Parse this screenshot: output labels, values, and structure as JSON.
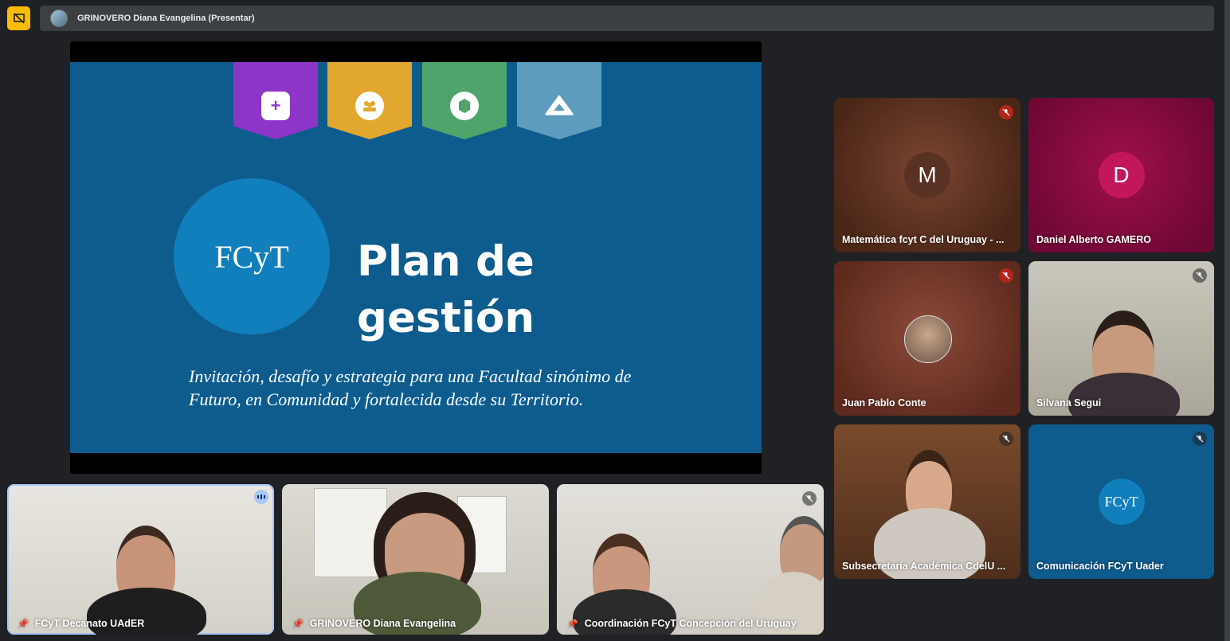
{
  "presenter_bar": {
    "title": "GRINOVERO Diana Evangelina (Presentar)"
  },
  "slide": {
    "logo_text": "FCyT",
    "title_line1": "Plan de",
    "title_line2": "gestión",
    "subtitle_line1": "Invitación, desafío y estrategia para una Facultad sinónimo de",
    "subtitle_line2": "Futuro, en Comunidad y fortalecida desde su Territorio."
  },
  "participants": [
    {
      "name": "Matemática fcyt C del Uruguay - ...",
      "avatar_letter": "M",
      "avatar_color": "#5a3223"
    },
    {
      "name": "Daniel Alberto GAMERO",
      "avatar_letter": "D",
      "avatar_color": "#c2185b"
    },
    {
      "name": "Juan Pablo Conte"
    },
    {
      "name": "Silvana Segui"
    },
    {
      "name": "Subsecretaría Académica CdelU ..."
    },
    {
      "name": "Comunicación FCyT Uader",
      "logo_text": "FCyT"
    }
  ],
  "bottom_tiles": [
    {
      "name": "FCyT Decanato UAdER"
    },
    {
      "name": "GRINOVERO Diana Evangelina"
    },
    {
      "name": "Coordinación FCyT Concepción del Uruguay"
    }
  ],
  "colors": {
    "accent": "#fbbc04",
    "slide_bg": "#0e5c8e",
    "active_speaker": "#a8c7fa"
  }
}
